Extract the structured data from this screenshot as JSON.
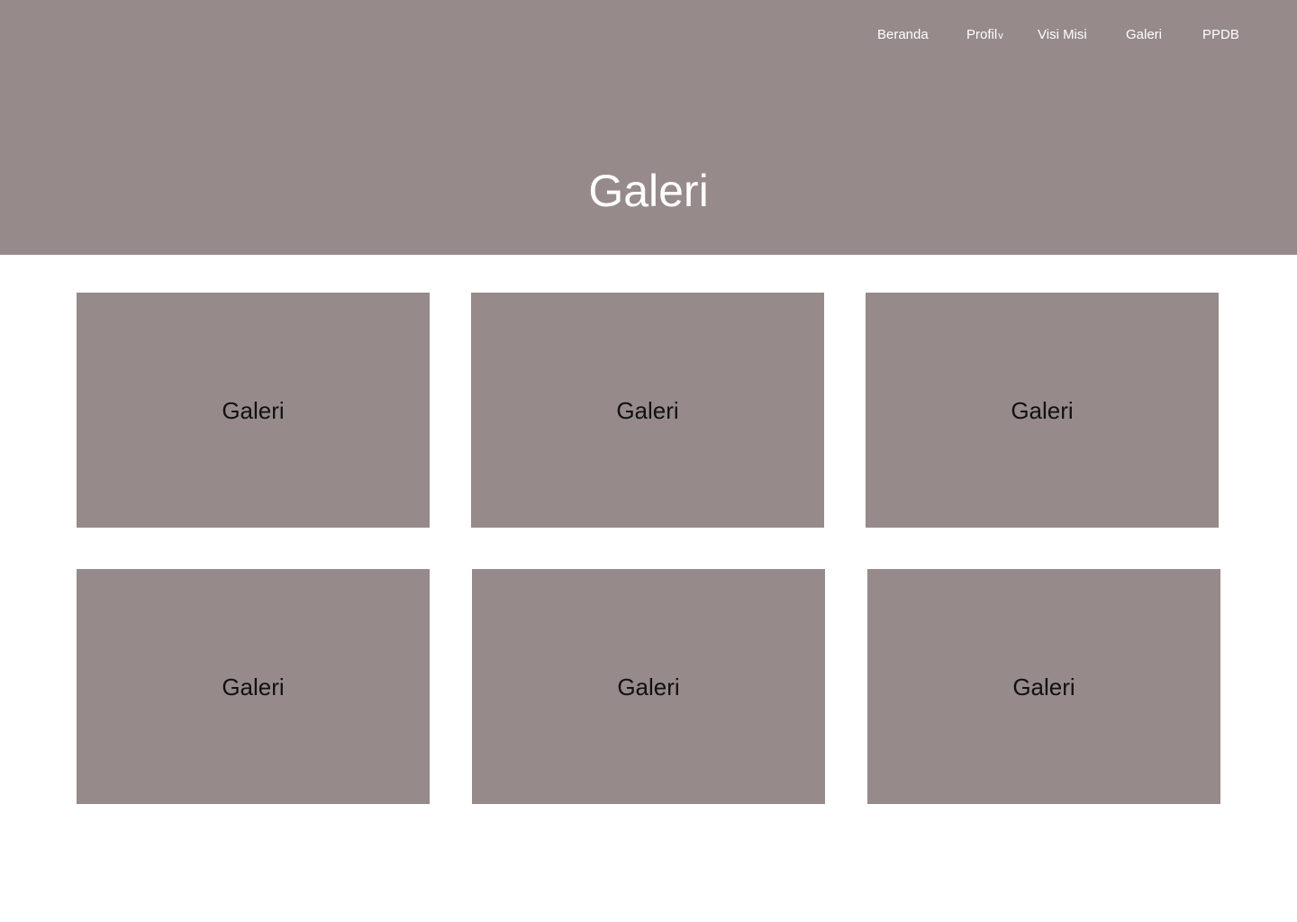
{
  "colors": {
    "hero_background": "#968b8a",
    "card_background": "#968b8a",
    "nav_text": "#ffffff",
    "hero_title": "#ffffff",
    "card_text": "#111111",
    "page_background": "#ffffff"
  },
  "nav": {
    "items": [
      {
        "label": "Beranda"
      },
      {
        "label": "Profil",
        "dropdown_icon": "chevron-down-icon"
      },
      {
        "label": "Visi Misi"
      },
      {
        "label": "Galeri"
      },
      {
        "label": "PPDB"
      }
    ]
  },
  "hero": {
    "title": "Galeri"
  },
  "gallery": {
    "items": [
      {
        "label": "Galeri"
      },
      {
        "label": "Galeri"
      },
      {
        "label": "Galeri"
      },
      {
        "label": "Galeri"
      },
      {
        "label": "Galeri"
      },
      {
        "label": "Galeri"
      }
    ]
  }
}
